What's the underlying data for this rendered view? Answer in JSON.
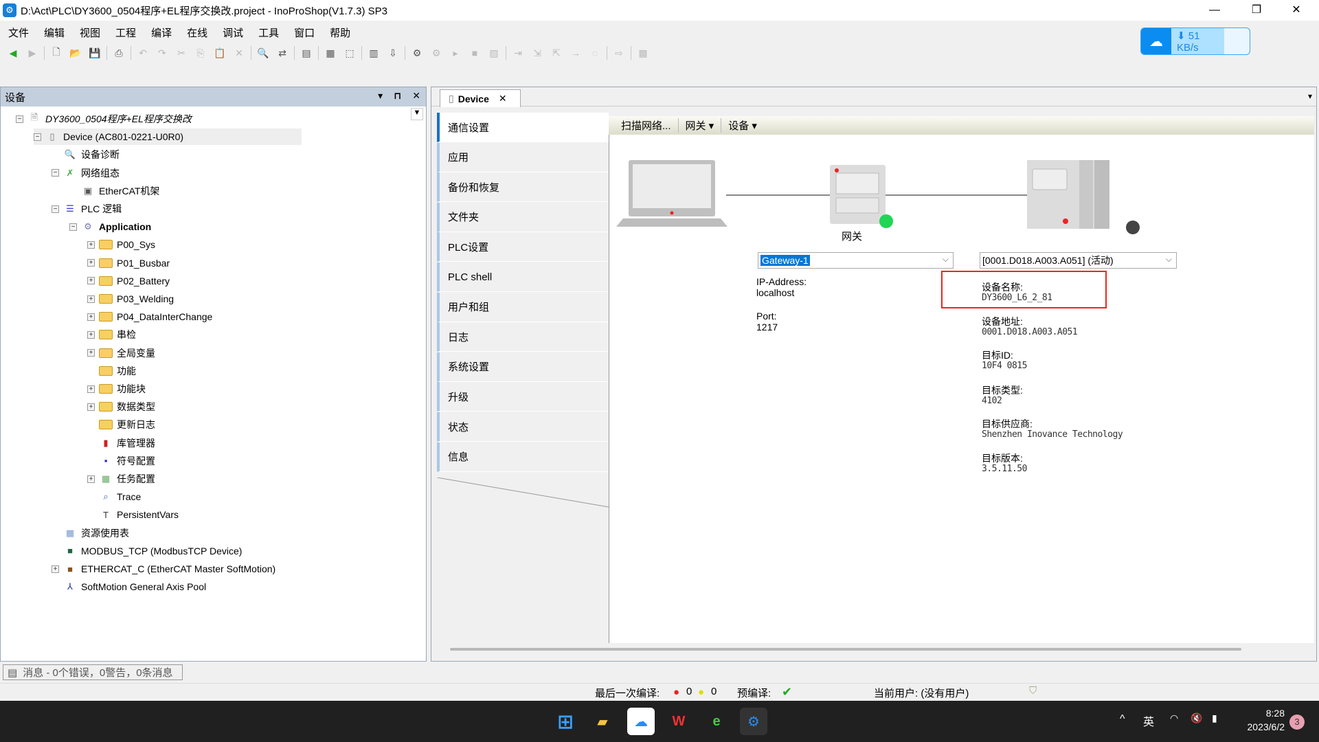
{
  "window": {
    "title": "D:\\Act\\PLC\\DY3600_0504程序+EL程序交换改.project - InoProShop(V1.7.3) SP3",
    "minimize": "—",
    "restore": "❐",
    "close": "✕"
  },
  "menu": [
    "文件",
    "编辑",
    "视图",
    "工程",
    "编译",
    "在线",
    "调试",
    "工具",
    "窗口",
    "帮助"
  ],
  "net_badge": {
    "speed": "⬇ 51 KB/s",
    "accent": "#0a8cf0"
  },
  "devices_panel": {
    "title": "设备",
    "dropdown": "▾",
    "pin": "⊓",
    "close": "✕",
    "tree": [
      {
        "label": "DY3600_0504程序+EL程序交换改",
        "level": 0,
        "exp": "−",
        "icon": "project-icon",
        "italic": true
      },
      {
        "label": "Device (AC801-0221-U0R0)",
        "level": 1,
        "exp": "−",
        "icon": "device-icon",
        "selected": true
      },
      {
        "label": "设备诊断",
        "level": 2,
        "icon": "diagnosis-icon"
      },
      {
        "label": "网络组态",
        "level": 2,
        "exp": "−",
        "icon": "tools-icon"
      },
      {
        "label": "EtherCAT机架",
        "level": 3,
        "icon": "rack-icon"
      },
      {
        "label": "PLC 逻辑",
        "level": 2,
        "exp": "−",
        "icon": "plc-logic-icon"
      },
      {
        "label": "Application",
        "level": 3,
        "exp": "−",
        "icon": "gear-icon",
        "bold": true
      },
      {
        "label": "P00_Sys",
        "level": 4,
        "exp": "+",
        "icon": "folder-icon"
      },
      {
        "label": "P01_Busbar",
        "level": 4,
        "exp": "+",
        "icon": "folder-icon"
      },
      {
        "label": "P02_Battery",
        "level": 4,
        "exp": "+",
        "icon": "folder-icon"
      },
      {
        "label": "P03_Welding",
        "level": 4,
        "exp": "+",
        "icon": "folder-icon"
      },
      {
        "label": "P04_DataInterChange",
        "level": 4,
        "exp": "+",
        "icon": "folder-icon"
      },
      {
        "label": "串检",
        "level": 4,
        "exp": "+",
        "icon": "folder-icon"
      },
      {
        "label": "全局变量",
        "level": 4,
        "exp": "+",
        "icon": "folder-icon"
      },
      {
        "label": "功能",
        "level": 4,
        "icon": "folder-icon"
      },
      {
        "label": "功能块",
        "level": 4,
        "exp": "+",
        "icon": "folder-icon"
      },
      {
        "label": "数据类型",
        "level": 4,
        "exp": "+",
        "icon": "folder-icon"
      },
      {
        "label": "更新日志",
        "level": 4,
        "icon": "folder-icon"
      },
      {
        "label": "库管理器",
        "level": 4,
        "icon": "library-icon"
      },
      {
        "label": "符号配置",
        "level": 4,
        "icon": "symbol-config-icon"
      },
      {
        "label": "任务配置",
        "level": 4,
        "exp": "+",
        "icon": "task-config-icon"
      },
      {
        "label": "Trace",
        "level": 4,
        "icon": "trace-icon"
      },
      {
        "label": "PersistentVars",
        "level": 4,
        "icon": "persistent-vars-icon"
      },
      {
        "label": "资源使用表",
        "level": 2,
        "icon": "table-icon"
      },
      {
        "label": "MODBUS_TCP (ModbusTCP Device)",
        "level": 2,
        "icon": "modbus-icon"
      },
      {
        "label": "ETHERCAT_C (EtherCAT Master SoftMotion)",
        "level": 2,
        "exp": "+",
        "icon": "ethercat-icon"
      },
      {
        "label": "SoftMotion General Axis Pool",
        "level": 2,
        "icon": "axis-pool-icon"
      }
    ]
  },
  "messages_tab": "消息 - 0个错误，0警告，0条消息",
  "editor": {
    "tab": "Device",
    "tab_close": "✕",
    "tab_menu": "▾",
    "nav": [
      "通信设置",
      "应用",
      "备份和恢复",
      "文件夹",
      "PLC设置",
      "PLC shell",
      "用户和组",
      "日志",
      "系统设置",
      "升级",
      "状态",
      "信息"
    ],
    "toolbar": [
      "扫描网络...",
      "网关 ▾",
      "设备 ▾"
    ],
    "gateway": {
      "label": "网关",
      "selected": "Gateway-1",
      "ip_label": "IP-Address:",
      "ip": "localhost",
      "port_label": "Port:",
      "port": "1217"
    },
    "device": {
      "selected": "[0001.D018.A003.A051] (活动)",
      "info": [
        {
          "label": "设备名称:",
          "value": "DY3600_L6_2_81"
        },
        {
          "label": "设备地址:",
          "value": "0001.D018.A003.A051"
        },
        {
          "label": "目标ID:",
          "value": "10F4 0815"
        },
        {
          "label": "目标类型:",
          "value": "4102"
        },
        {
          "label": "目标供应商:",
          "value": "Shenzhen Inovance Technology"
        },
        {
          "label": "目标版本:",
          "value": "3.5.11.50"
        }
      ],
      "highlight_color": "#e8291c"
    },
    "gateway_status_color": "#1fd655"
  },
  "status": {
    "last_compile": "最后一次编译:",
    "errors": "0",
    "warnings": "0",
    "precompile": "预编译:",
    "precompile_ok": "✔",
    "user": "当前用户: (没有用户)"
  },
  "taskbar": {
    "time": "8:28",
    "date": "2023/6/2",
    "ime": "英",
    "notifications": "3",
    "tray_chevron": "^"
  }
}
